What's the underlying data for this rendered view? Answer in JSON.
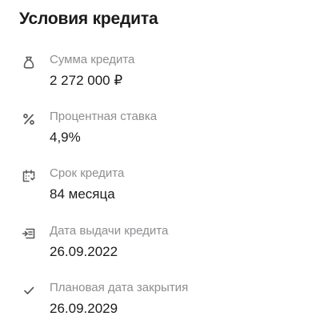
{
  "section": {
    "title": "Условия кредита"
  },
  "items": [
    {
      "icon": "money-bag-icon",
      "label": "Сумма кредита",
      "value": "2 272 000 ₽"
    },
    {
      "icon": "percent-icon",
      "label": "Процентная ставка",
      "value": "4,9%"
    },
    {
      "icon": "calendar-icon",
      "label": "Срок кредита",
      "value": "84 месяца"
    },
    {
      "icon": "issue-transfer-icon",
      "label": "Дата выдачи кредита",
      "value": "26.09.2022"
    },
    {
      "icon": "checkmark-icon",
      "label": "Плановая дата закрытия",
      "value": "26.09.2029"
    }
  ],
  "colors": {
    "label": "#8e8e93",
    "value": "#1c1c1e",
    "icon": "#5b5b60"
  }
}
